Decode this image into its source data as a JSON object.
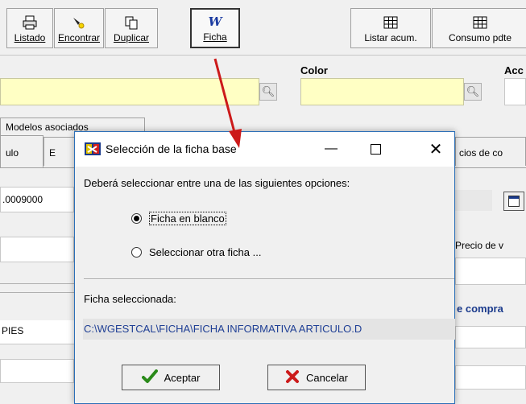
{
  "toolbar": {
    "buttons": [
      {
        "label": "Listado",
        "icon": "printer-icon"
      },
      {
        "label": "Encontrar",
        "icon": "flashlight-icon"
      },
      {
        "label": "Duplicar",
        "icon": "copy-icon"
      },
      {
        "label": "Ficha",
        "icon": "word-icon"
      },
      {
        "label": "Listar acum.",
        "icon": "grid-icon"
      },
      {
        "label": "Consumo pdte",
        "icon": "grid-icon"
      }
    ]
  },
  "form": {
    "color_label": "Color",
    "acc_label": "Acc",
    "tab_modelos": "Modelos asociados",
    "tab_ulo": "ulo",
    "tab_e": "E",
    "tab_precios": "cios de co",
    "code_value": ".0009000",
    "precio_label": "Precio de v",
    "compra_label": "e compra",
    "pies_value": "PIES"
  },
  "dialog": {
    "title": "Selección de la ficha base",
    "prompt": "Deberá seleccionar entre una de las siguientes opciones:",
    "option1": "Ficha en blanco",
    "option2": "Seleccionar otra ficha ...",
    "selected_label": "Ficha seleccionada:",
    "selected_path": "C:\\WGESTCAL\\FICHA\\FICHA INFORMATIVA ARTICULO.D",
    "accept_label": "Aceptar",
    "cancel_label": "Cancelar",
    "selected_option": 1
  },
  "colors": {
    "arrow": "#cc1a1a",
    "path_text": "#1f3f95",
    "yellow_field": "#ffffc4",
    "compra_text": "#1a3a8c"
  }
}
